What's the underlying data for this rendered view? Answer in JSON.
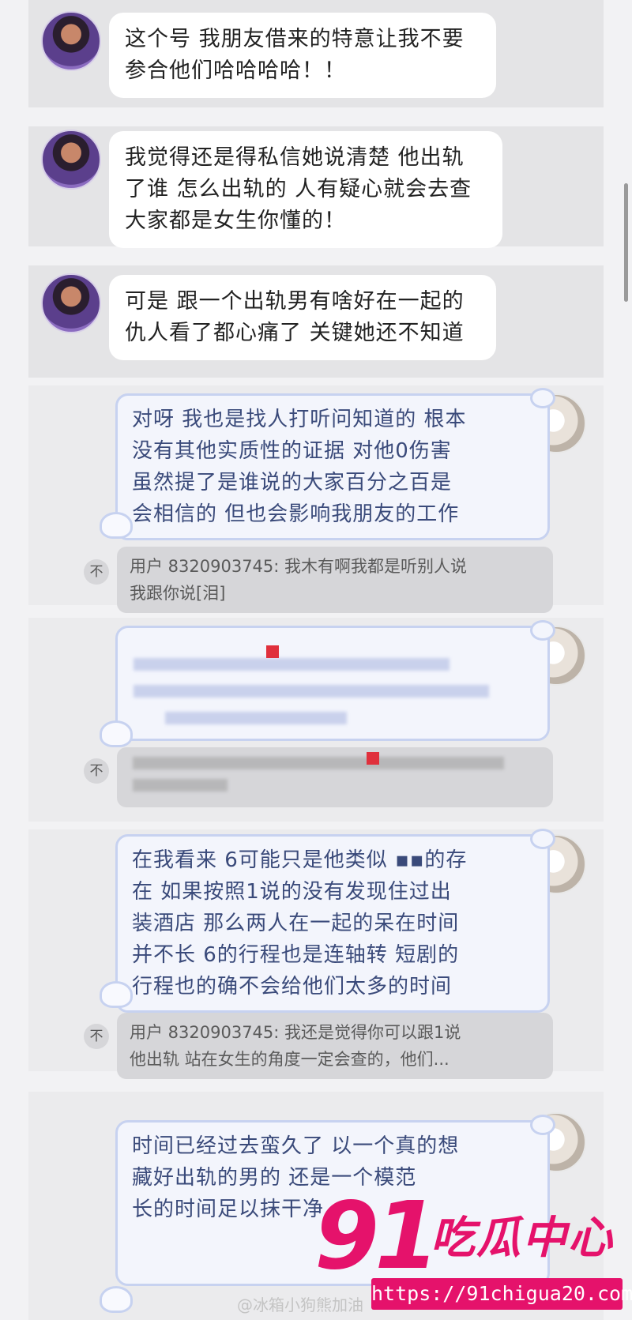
{
  "messages_left": [
    {
      "line1": "这个号 我朋友借来的特意让我不要",
      "line2": "参合他们哈哈哈哈！！"
    },
    {
      "line1": "我觉得还是得私信她说清楚 他出轨",
      "line2": "了谁 怎么出轨的 人有疑心就会去查",
      "line3": "大家都是女生你懂的！"
    },
    {
      "line1": "可是 跟一个出轨男有啥好在一起的",
      "line2": "仇人看了都心痛了 关键她还不知道"
    }
  ],
  "reply1": {
    "lines": [
      "对呀 我也是找人打听问知道的 根本",
      "没有其他实质性的证据 对他0伤害",
      "虽然提了是谁说的大家百分之百是",
      "会相信的 但也会影响我朋友的工作"
    ],
    "quote_line1": "用户 8320903745: 我木有啊我都是听别人说",
    "quote_line2": "我跟你说[泪]"
  },
  "reply3": {
    "lines": [
      "在我看来 6可能只是他类似 ▪▪的存",
      "在 如果按照1说的没有发现住过出",
      "装酒店 那么两人在一起的呆在时间",
      "并不长 6的行程也是连轴转 短剧的",
      "行程也的确不会给他们太多的时间"
    ],
    "quote_line1": "用户 8320903745: 我还是觉得你可以跟1说",
    "quote_line2": "他出轨 站在女生的角度一定会查的，他们..."
  },
  "reply4": {
    "lines": [
      "时间已经过去蛮久了 以一个真的想",
      "藏好出轨的男的 还是一个模范",
      "长的时间足以抹干净"
    ]
  },
  "quote_icon_glyph": "不",
  "watermark": {
    "number": "91",
    "text": "吃瓜中心",
    "url": "https://91chigua20.com",
    "weibo": "@冰箱小狗熊加油"
  },
  "colors": {
    "watermark": "#e5126b",
    "bubble_border": "#c7d2f0",
    "bubble_text": "#3a4a7a"
  }
}
